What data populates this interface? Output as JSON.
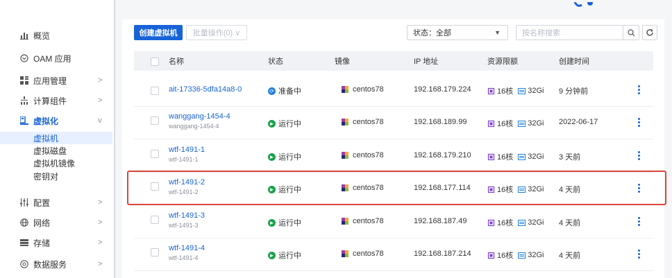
{
  "sidebar": {
    "items": [
      {
        "label": "概览",
        "icon": "bar-chart-icon"
      },
      {
        "label": "OAM 应用",
        "icon": "oam-icon"
      },
      {
        "label": "应用管理",
        "icon": "grid-icon",
        "chevron": ">"
      },
      {
        "label": "计算组件",
        "icon": "tree-icon",
        "chevron": ">"
      },
      {
        "label": "虚拟化",
        "icon": "virtualization-icon",
        "chevron": "v",
        "active": true
      },
      {
        "label": "配置",
        "icon": "sliders-icon",
        "chevron": ">"
      },
      {
        "label": "网络",
        "icon": "globe-icon",
        "chevron": ">"
      },
      {
        "label": "存储",
        "icon": "storage-icon",
        "chevron": ">"
      },
      {
        "label": "数据服务",
        "icon": "data-service-icon",
        "chevron": ">"
      }
    ],
    "sub_items": [
      {
        "label": "虚拟机",
        "selected": true
      },
      {
        "label": "虚拟磁盘"
      },
      {
        "label": "虚拟机镜像"
      },
      {
        "label": "密钥对"
      }
    ]
  },
  "toolbar": {
    "create_label": "创建虚拟机",
    "batch_label": "批量操作(0) ∨",
    "status_filter_label": "状态：全部",
    "search_placeholder": "按名称搜索"
  },
  "table": {
    "headers": [
      "名称",
      "状态",
      "镜像",
      "IP 地址",
      "资源限额",
      "创建时间"
    ],
    "rows": [
      {
        "name": "ait-17336-5dfa14a8-0",
        "sub": "",
        "status": "准备中",
        "status_color": "blue",
        "image": "centos78",
        "ip": "192.168.179.224",
        "cpu": "16核",
        "mem": "32Gi",
        "created": "9 分钟前"
      },
      {
        "name": "wanggang-1454-4",
        "sub": "wanggang-1454-4",
        "status": "运行中",
        "status_color": "green",
        "image": "centos78",
        "ip": "192.168.189.99",
        "cpu": "16核",
        "mem": "32Gi",
        "created": "2022-06-17"
      },
      {
        "name": "wtf-1491-1",
        "sub": "wtf-1491-1",
        "status": "运行中",
        "status_color": "green",
        "image": "centos78",
        "ip": "192.168.179.210",
        "cpu": "16核",
        "mem": "32Gi",
        "created": "3 天前"
      },
      {
        "name": "wtf-1491-2",
        "sub": "wtf-1491-2",
        "status": "运行中",
        "status_color": "green",
        "image": "centos78",
        "ip": "192.168.177.114",
        "cpu": "16核",
        "mem": "32Gi",
        "created": "4 天前"
      },
      {
        "name": "wtf-1491-3",
        "sub": "wtf-1491-3",
        "status": "运行中",
        "status_color": "green",
        "image": "centos78",
        "ip": "192.168.187.49",
        "cpu": "16核",
        "mem": "32Gi",
        "created": "4 天前"
      },
      {
        "name": "wtf-1491-4",
        "sub": "wtf-1491-4",
        "status": "运行中",
        "status_color": "green",
        "image": "centos78",
        "ip": "192.168.187.214",
        "cpu": "16核",
        "mem": "32Gi",
        "created": "4 天前"
      }
    ]
  },
  "colors": {
    "accent": "#1863d8",
    "running": "#18a24a",
    "preparing": "#1d7fe0",
    "highlight": "#d9443a"
  }
}
